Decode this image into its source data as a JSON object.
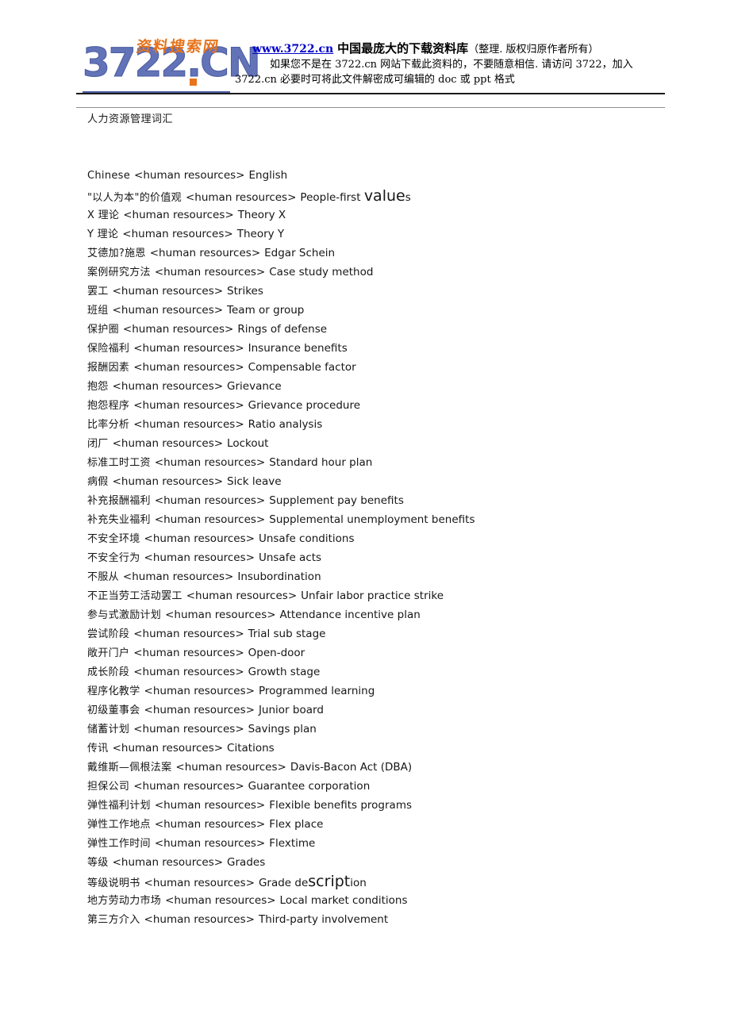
{
  "header": {
    "logo": {
      "main_text": "3722.CN",
      "calligraphy_text": "资料搜索网",
      "main_color": "#6273b8",
      "accent_color": "#e8741c"
    },
    "line1": {
      "url": "www.3722.cn",
      "strong": "中国最庞大的下载资料库",
      "paren": "（整理. 版权归原作者所有）"
    },
    "line2": "如果您不是在 3722.cn 网站下载此资料的，不要随意相信. 请访问 3722，加入",
    "line3": "3722.cn 必要时可将此文件解密成可编辑的 doc 或 ppt 格式",
    "link_color": "#0000cc"
  },
  "document": {
    "title": "人力资源管理词汇"
  },
  "glossary": {
    "separator": "<human resources>",
    "entries": [
      {
        "zh": "Chinese",
        "en": "English"
      },
      {
        "zh": "\"以人为本\"的价值观",
        "en_pre": "People-first ",
        "en_big": "value",
        "en_post": "s"
      },
      {
        "zh": "X 理论",
        "en": "Theory X"
      },
      {
        "zh": "Y 理论",
        "en": "Theory Y"
      },
      {
        "zh": "艾德加?施恩",
        "en": "Edgar Schein"
      },
      {
        "zh": "案例研究方法",
        "en": "Case study method"
      },
      {
        "zh": "罢工",
        "en": "Strikes"
      },
      {
        "zh": "班组",
        "en": "Team or group"
      },
      {
        "zh": "保护圈",
        "en": "Rings of defense"
      },
      {
        "zh": "保险福利",
        "en": "Insurance benefits"
      },
      {
        "zh": "报酬因素",
        "en": "Compensable factor"
      },
      {
        "zh": "抱怨",
        "en": "Grievance"
      },
      {
        "zh": "抱怨程序",
        "en": "Grievance procedure"
      },
      {
        "zh": "比率分析",
        "en": "Ratio analysis"
      },
      {
        "zh": "闭厂",
        "en": "Lockout"
      },
      {
        "zh": "标准工时工资",
        "en": "Standard hour plan"
      },
      {
        "zh": "病假",
        "en": "Sick leave"
      },
      {
        "zh": "补充报酬福利",
        "en": "Supplement pay benefits"
      },
      {
        "zh": "补充失业福利",
        "en": "Supplemental unemployment benefits"
      },
      {
        "zh": "不安全环境",
        "en": "Unsafe conditions"
      },
      {
        "zh": "不安全行为",
        "en": "Unsafe acts"
      },
      {
        "zh": "不服从",
        "en": "Insubordination"
      },
      {
        "zh": "不正当劳工活动罢工",
        "en": "Unfair labor practice strike"
      },
      {
        "zh": "参与式激励计划",
        "en": "Attendance incentive plan"
      },
      {
        "zh": "尝试阶段",
        "en": "Trial sub stage"
      },
      {
        "zh": "敞开门户",
        "en": "Open-door"
      },
      {
        "zh": "成长阶段",
        "en": "Growth stage"
      },
      {
        "zh": "程序化教学",
        "en": "Programmed learning"
      },
      {
        "zh": "初级董事会",
        "en": "Junior board"
      },
      {
        "zh": "储蓄计划",
        "en": "Savings plan"
      },
      {
        "zh": "传讯",
        "en": "Citations"
      },
      {
        "zh": "戴维斯—佩根法案",
        "en": "Davis-Bacon Act (DBA)"
      },
      {
        "zh": "担保公司",
        "en": "Guarantee corporation"
      },
      {
        "zh": "弹性福利计划",
        "en": "Flexible benefits programs"
      },
      {
        "zh": "弹性工作地点",
        "en": "Flex place"
      },
      {
        "zh": "弹性工作时间",
        "en": "Flextime"
      },
      {
        "zh": "等级",
        "en": "Grades"
      },
      {
        "zh": "等级说明书",
        "en_pre": "Grade de",
        "en_big": "script",
        "en_post": "ion"
      },
      {
        "zh": "地方劳动力市场",
        "en": "Local market conditions"
      },
      {
        "zh": "第三方介入",
        "en": "Third-party involvement"
      }
    ]
  }
}
